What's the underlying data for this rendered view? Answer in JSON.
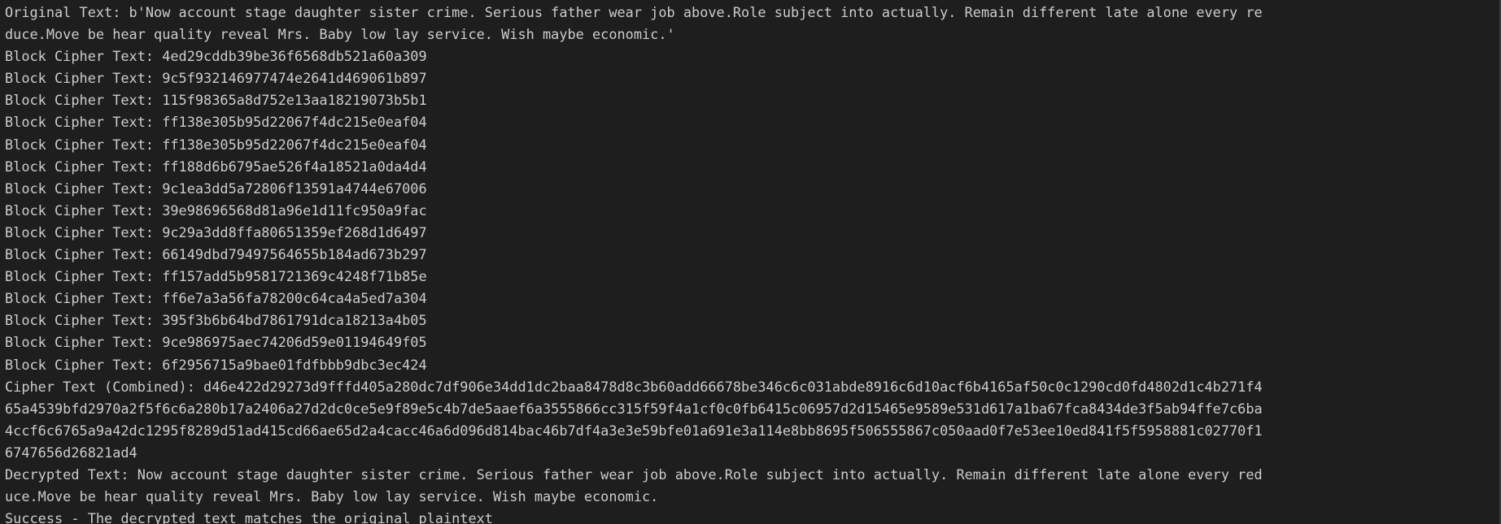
{
  "terminal": {
    "lines": [
      "Original Text: b'Now account stage daughter sister crime. Serious father wear job above.Role subject into actually. Remain different late alone every re",
      "duce.Move be hear quality reveal Mrs. Baby low lay service. Wish maybe economic.'",
      "Block Cipher Text: 4ed29cddb39be36f6568db521a60a309",
      "Block Cipher Text: 9c5f932146977474e2641d469061b897",
      "Block Cipher Text: 115f98365a8d752e13aa18219073b5b1",
      "Block Cipher Text: ff138e305b95d22067f4dc215e0eaf04",
      "Block Cipher Text: ff138e305b95d22067f4dc215e0eaf04",
      "Block Cipher Text: ff188d6b6795ae526f4a18521a0da4d4",
      "Block Cipher Text: 9c1ea3dd5a72806f13591a4744e67006",
      "Block Cipher Text: 39e98696568d81a96e1d11fc950a9fac",
      "Block Cipher Text: 9c29a3dd8ffa80651359ef268d1d6497",
      "Block Cipher Text: 66149dbd79497564655b184ad673b297",
      "Block Cipher Text: ff157add5b9581721369c4248f71b85e",
      "Block Cipher Text: ff6e7a3a56fa78200c64ca4a5ed7a304",
      "Block Cipher Text: 395f3b6b64bd7861791dca18213a4b05",
      "Block Cipher Text: 9ce986975aec74206d59e01194649f05",
      "Block Cipher Text: 6f2956715a9bae01fdfbbb9dbc3ec424",
      "Cipher Text (Combined): d46e422d29273d9fffd405a280dc7df906e34dd1dc2baa8478d8c3b60add66678be346c6c031abde8916c6d10acf6b4165af50c0c1290cd0fd4802d1c4b271f4",
      "65a4539bfd2970a2f5f6c6a280b17a2406a27d2dc0ce5e9f89e5c4b7de5aaef6a3555866cc315f59f4a1cf0c0fb6415c06957d2d15465e9589e531d617a1ba67fca8434de3f5ab94ffe7c6ba",
      "4ccf6c6765a9a42dc1295f8289d51ad415cd66ae65d2a4cacc46a6d096d814bac46b7df4a3e3e59bfe01a691e3a114e8bb8695f506555867c050aad0f7e53ee10ed841f5f5958881c02770f1",
      "6747656d26821ad4",
      "Decrypted Text: Now account stage daughter sister crime. Serious father wear job above.Role subject into actually. Remain different late alone every red",
      "uce.Move be hear quality reveal Mrs. Baby low lay service. Wish maybe economic.",
      "Success - The decrypted text matches the original plaintext"
    ]
  }
}
